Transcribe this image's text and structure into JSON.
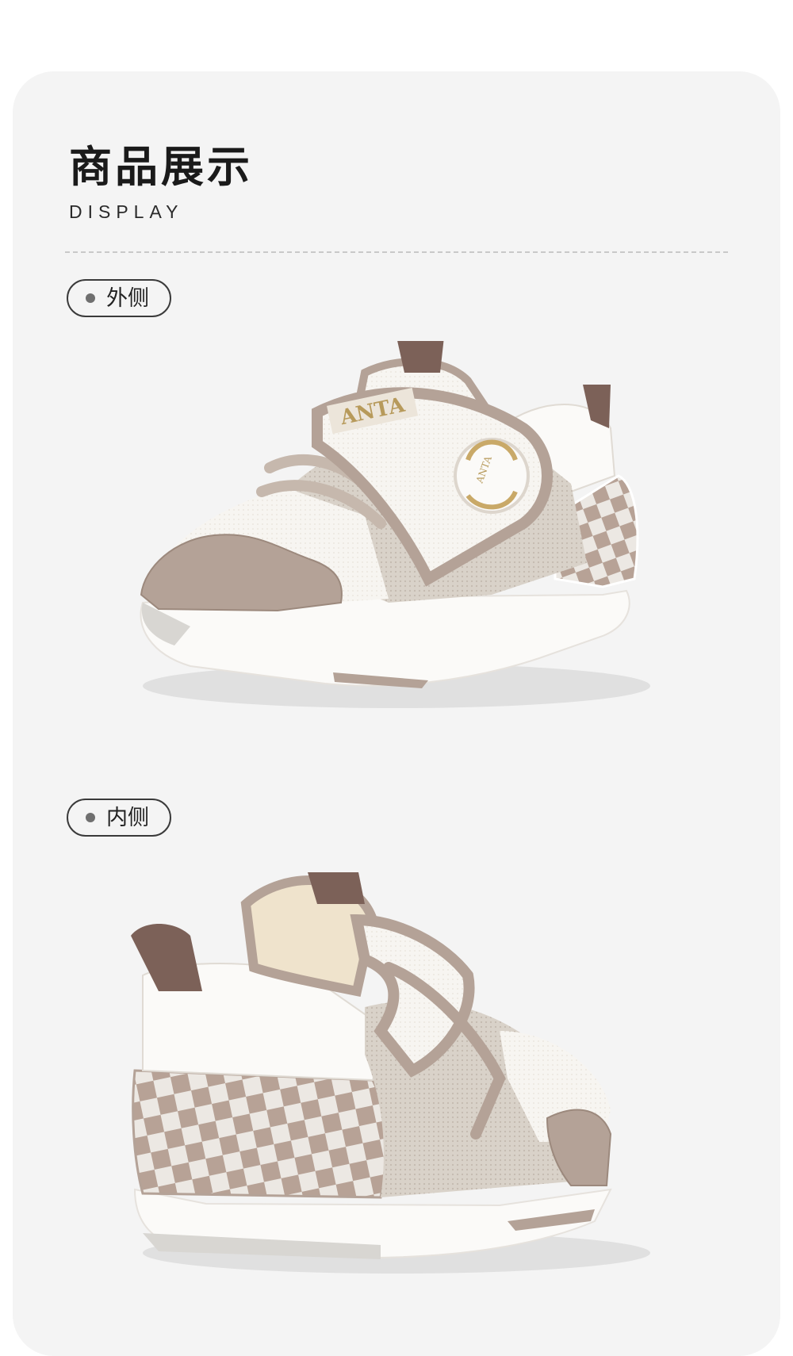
{
  "header": {
    "title": "商品展示",
    "subtitle": "DISPLAY"
  },
  "views": [
    {
      "label": "外侧"
    },
    {
      "label": "内侧"
    }
  ],
  "colors": {
    "card_bg": "#f4f4f4",
    "taupe": "#b4a297",
    "strap_brown": "#7c6158",
    "mesh_white": "#f6f4f1",
    "sole_white": "#fbfaf8",
    "logo_gold": "#b79a5b"
  }
}
